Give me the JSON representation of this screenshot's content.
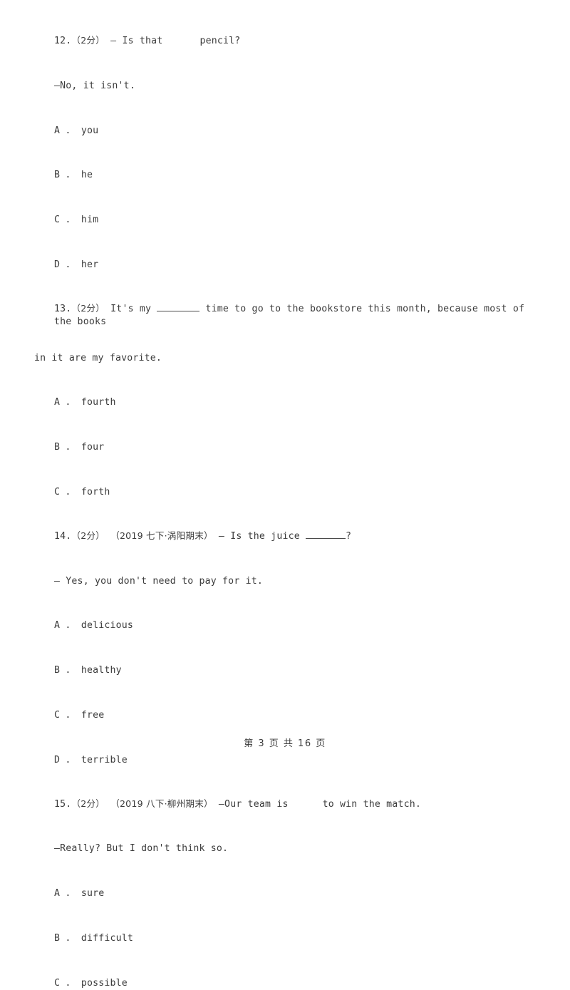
{
  "document": {
    "footer": "第 3 页 共 16 页"
  },
  "questions": [
    {
      "number": "12.",
      "score": "（2分）",
      "source": "",
      "stem_before": "— Is that",
      "blank_type": "space",
      "stem_after": "pencil?",
      "stem_wrap": "",
      "answer_line": "—No, it isn't.",
      "options": [
        {
          "letter": "A ．",
          "text": "you"
        },
        {
          "letter": "B ．",
          "text": "he"
        },
        {
          "letter": "C ．",
          "text": "him"
        },
        {
          "letter": "D ．",
          "text": "her"
        }
      ]
    },
    {
      "number": "13.",
      "score": "（2分）",
      "source": "",
      "stem_before": "It's my",
      "blank_type": "underline",
      "stem_after": "time to go to the bookstore this month, because most of the books",
      "stem_wrap": "in it are my favorite.",
      "answer_line": "",
      "options": [
        {
          "letter": "A ．",
          "text": "fourth"
        },
        {
          "letter": "B ．",
          "text": "four"
        },
        {
          "letter": "C ．",
          "text": "forth"
        }
      ]
    },
    {
      "number": "14.",
      "score": "（2分）",
      "source": "（2019 七下·涡阳期末）",
      "stem_before": "— Is the juice",
      "blank_type": "underline",
      "stem_after": "?",
      "stem_wrap": "",
      "answer_line": "— Yes, you don't need to pay for it.",
      "options": [
        {
          "letter": "A ．",
          "text": "delicious"
        },
        {
          "letter": "B ．",
          "text": "healthy"
        },
        {
          "letter": "C ．",
          "text": "free"
        },
        {
          "letter": "D ．",
          "text": "terrible"
        }
      ]
    },
    {
      "number": "15.",
      "score": "（2分）",
      "source": "（2019 八下·柳州期末）",
      "stem_before": "—Our team is",
      "blank_type": "space",
      "stem_after": "to win the match.",
      "stem_wrap": "",
      "answer_line": "—Really? But I don't think so.",
      "options": [
        {
          "letter": "A ．",
          "text": "sure"
        },
        {
          "letter": "B ．",
          "text": "difficult"
        },
        {
          "letter": "C ．",
          "text": "possible"
        }
      ]
    }
  ]
}
